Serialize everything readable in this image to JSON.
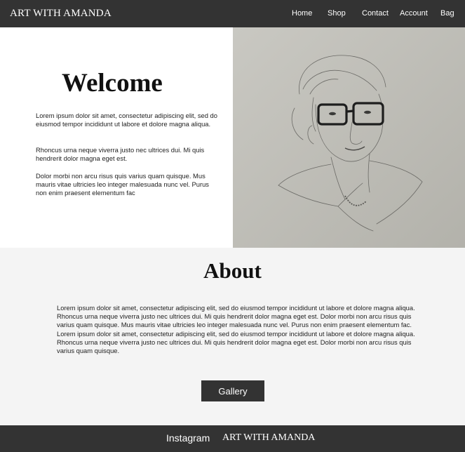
{
  "header": {
    "brand": "ART WITH AMANDA",
    "nav": [
      {
        "label": "Home"
      },
      {
        "label": "Shop"
      },
      {
        "label": "Contact"
      },
      {
        "label": "Account"
      },
      {
        "label": "Bag"
      }
    ]
  },
  "hero": {
    "title": "Welcome",
    "paragraphs": [
      "Lorem ipsum dolor sit amet, consectetur adipiscing elit, sed do eiusmod tempor incididunt ut labore et dolore magna aliqua.",
      " Rhoncus urna neque viverra justo nec ultrices dui. Mi quis hendrerit dolor magna eget est.",
      "Dolor morbi non arcu risus quis varius quam quisque. Mus mauris vitae ultricies leo integer malesuada nunc vel. Purus non enim praesent elementum fac"
    ]
  },
  "about": {
    "title": "About",
    "text": "Lorem ipsum dolor sit amet, consectetur adipiscing elit, sed do eiusmod tempor incididunt ut labore et dolore magna aliqua. Rhoncus urna neque viverra justo nec ultrices dui. Mi quis hendrerit dolor magna eget est. Dolor morbi non arcu risus quis varius quam quisque. Mus mauris vitae ultricies leo integer malesuada nunc vel. Purus non enim praesent elementum fac. Lorem ipsum dolor sit amet, consectetur adipiscing elit, sed do eiusmod tempor incididunt ut labore et dolore magna aliqua. Rhoncus urna neque viverra justo nec ultrices dui. Mi quis hendrerit dolor magna eget est. Dolor morbi non arcu risus quis varius quam quisque.",
    "button_label": "Gallery"
  },
  "footer": {
    "instagram_label": "Instagram",
    "brand": "ART WITH AMANDA"
  },
  "colors": {
    "bar": "#333333",
    "about_bg": "#f4f4f4",
    "paper": "#bdbcb5"
  }
}
